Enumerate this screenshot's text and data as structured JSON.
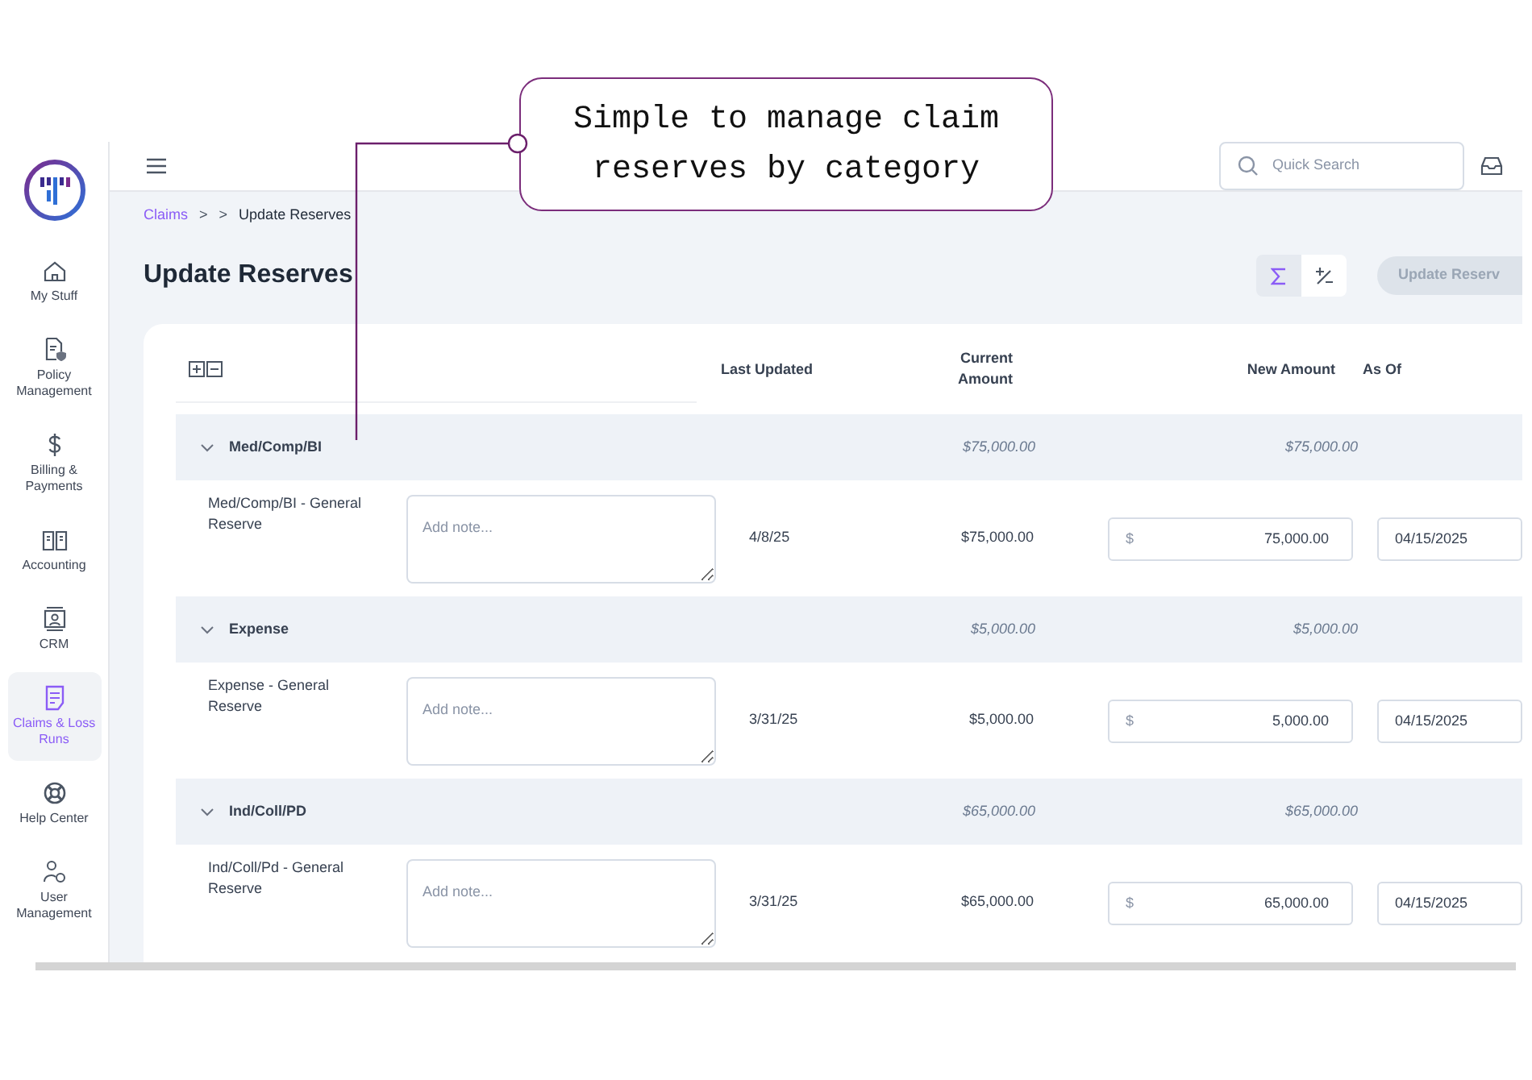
{
  "callout": {
    "text": "Simple to manage claim reserves by category"
  },
  "sidebar": {
    "items": [
      {
        "label": "My Stuff",
        "kind": "home",
        "selected": false
      },
      {
        "label": "Policy Management",
        "kind": "policy",
        "selected": false
      },
      {
        "label": "Billing & Payments",
        "kind": "dollar",
        "selected": false
      },
      {
        "label": "Accounting",
        "kind": "book",
        "selected": false
      },
      {
        "label": "CRM",
        "kind": "contact",
        "selected": false
      },
      {
        "label": "Claims & Loss Runs",
        "kind": "claims",
        "selected": true
      },
      {
        "label": "Help Center",
        "kind": "help",
        "selected": false
      },
      {
        "label": "User Management",
        "kind": "users",
        "selected": false
      }
    ]
  },
  "header": {
    "search": {
      "placeholder": "Quick Search"
    }
  },
  "breadcrumb": [
    {
      "text": "Claims",
      "kind": "link"
    },
    {
      "text": ">",
      "kind": "separator"
    },
    {
      "text": ">",
      "kind": "separator"
    },
    {
      "text": "Update Reserves",
      "kind": "current"
    }
  ],
  "title": "Update Reserves",
  "toolbar": {
    "toggles": [
      {
        "kind": "sum",
        "selected": true
      },
      {
        "kind": "plusminus",
        "selected": false
      }
    ],
    "button": {
      "label": "Update Reserv",
      "disabled": true
    }
  },
  "table": {
    "columns": [
      "Last Updated",
      "Current Amount",
      "New Amount",
      "As Of"
    ],
    "groups": [
      {
        "name": "Med/Comp/BI",
        "expanded": true,
        "current": "$75,000.00",
        "new": "$75,000.00",
        "rows": [
          {
            "name": "Med/Comp/BI - General Reserve",
            "note_placeholder": "Add note...",
            "last_updated": "4/8/25",
            "current": "$75,000.00",
            "currency": "$",
            "new_amount": "75,000.00",
            "as_of": "04/15/2025"
          }
        ]
      },
      {
        "name": "Expense",
        "expanded": true,
        "current": "$5,000.00",
        "new": "$5,000.00",
        "rows": [
          {
            "name": "Expense - General Reserve",
            "note_placeholder": "Add note...",
            "last_updated": "3/31/25",
            "current": "$5,000.00",
            "currency": "$",
            "new_amount": "5,000.00",
            "as_of": "04/15/2025"
          }
        ]
      },
      {
        "name": "Ind/Coll/PD",
        "expanded": true,
        "current": "$65,000.00",
        "new": "$65,000.00",
        "rows": [
          {
            "name": "Ind/Coll/Pd - General Reserve",
            "note_placeholder": "Add note...",
            "last_updated": "3/31/25",
            "current": "$65,000.00",
            "currency": "$",
            "new_amount": "65,000.00",
            "as_of": "04/15/2025"
          }
        ]
      }
    ]
  }
}
